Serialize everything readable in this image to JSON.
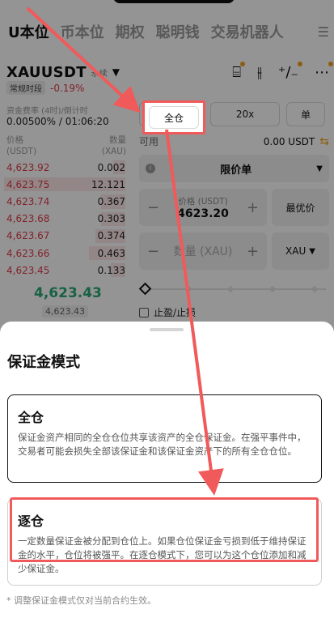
{
  "tabs": [
    "U本位",
    "币本位",
    "期权",
    "聪明钱",
    "交易机器人"
  ],
  "pair": {
    "symbol": "XAUUSDT",
    "tag": "永续",
    "session": "常规时段",
    "change": "-0.19%"
  },
  "icons": {
    "gift": "gift-icon",
    "candles": "candlestick-icon",
    "calc": "calculator-icon",
    "more": "more-icon"
  },
  "funding": {
    "label": "资金费率 (4时)/倒计时",
    "value": "0.00500% / 01:06:20"
  },
  "orderbook": {
    "price_header": "价格",
    "price_unit": "(USDT)",
    "qty_header": "数量",
    "qty_unit": "(XAU)",
    "asks": [
      {
        "price": "4,623.92",
        "qty": "0.002",
        "depth": 0.1
      },
      {
        "price": "4,623.75",
        "qty": "12.121",
        "depth": 1.0
      },
      {
        "price": "4,623.74",
        "qty": "0.367",
        "depth": 0.2
      },
      {
        "price": "4,623.68",
        "qty": "0.303",
        "depth": 0.2
      },
      {
        "price": "4,623.67",
        "qty": "0.374",
        "depth": 0.25
      },
      {
        "price": "4,623.66",
        "qty": "0.463",
        "depth": 0.3
      },
      {
        "price": "4,623.45",
        "qty": "0.133",
        "depth": 0.12
      }
    ],
    "last_price": "4,623.43",
    "mark_price": "4,623.43"
  },
  "order": {
    "margin_mode": "全仓",
    "leverage": "20x",
    "single": "单",
    "available_label": "可用",
    "available_value": "0.00 USDT",
    "order_type": "限价单",
    "price_label": "价格 (USDT)",
    "price_value": "4623.20",
    "best_price": "最优价",
    "qty_placeholder": "数量 (XAU)",
    "qty_unit": "XAU",
    "tpsl": "止盈/止损"
  },
  "sheet": {
    "title": "保证金模式",
    "cross_title": "全仓",
    "cross_desc": "保证金资产相同的全仓仓位共享该资产的全仓保证金。在强平事件中，交易者可能会损失全部该保证金和该保证金资产下的所有全仓仓位。",
    "isolated_title": "逐仓",
    "isolated_desc": "一定数量保证金被分配到仓位上。如果仓位保证金亏损到低于维持保证金的水平，仓位将被强平。在逐仓模式下，您可以为这个仓位添加和减少保证金。",
    "note": "* 调整保证金模式仅对当前合约生效。"
  },
  "colors": {
    "highlight": "#f05a5a",
    "sell": "#e03b4b",
    "buy": "#2aa876",
    "accent": "#f0a020"
  }
}
